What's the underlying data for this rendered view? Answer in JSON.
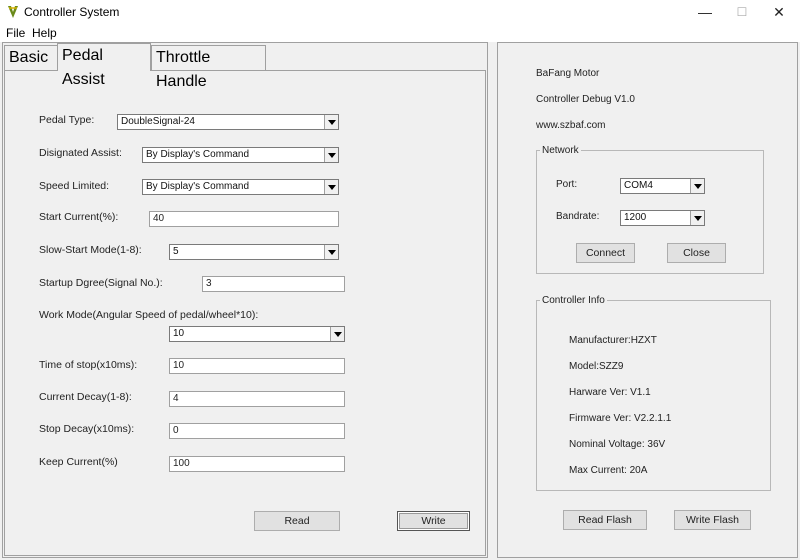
{
  "window": {
    "title": "Controller System",
    "minimize": "—",
    "maximize": "☐",
    "close": "✕"
  },
  "menu": {
    "file": "File",
    "help": "Help"
  },
  "tabs": {
    "basic": "Basic",
    "pedal_assist": "Pedal Assist",
    "throttle_handle": "Throttle Handle"
  },
  "form": {
    "pedal_type": {
      "label": "Pedal Type:",
      "value": "DoubleSignal-24"
    },
    "designated_assist": {
      "label": "Disignated Assist:",
      "value": "By Display's Command"
    },
    "speed_limited": {
      "label": "Speed Limited:",
      "value": "By Display's Command"
    },
    "start_current": {
      "label": "Start Current(%):",
      "value": "40"
    },
    "slow_start_mode": {
      "label": "Slow-Start Mode(1-8):",
      "value": "5"
    },
    "startup_degree": {
      "label": "Startup Dgree(Signal No.):",
      "value": "3"
    },
    "work_mode": {
      "label": "Work Mode(Angular Speed of pedal/wheel*10):",
      "value": "10"
    },
    "time_of_stop": {
      "label": "Time of stop(x10ms):",
      "value": "10"
    },
    "current_decay": {
      "label": "Current Decay(1-8):",
      "value": "4"
    },
    "stop_decay": {
      "label": "Stop Decay(x10ms):",
      "value": "0"
    },
    "keep_current": {
      "label": "Keep Current(%)",
      "value": "100"
    },
    "read_button": "Read",
    "write_button": "Write"
  },
  "about": {
    "brand": "BaFang Motor",
    "version": "Controller Debug V1.0",
    "website": "www.szbaf.com"
  },
  "network": {
    "title": "Network",
    "port_label": "Port:",
    "port_value": "COM4",
    "baudrate_label": "Bandrate:",
    "baudrate_value": "1200",
    "connect_button": "Connect",
    "close_button": "Close"
  },
  "controller_info": {
    "title": "Controller Info",
    "manufacturer": "Manufacturer:HZXT",
    "model": "Model:SZZ9",
    "hardware": "Harware Ver: V1.1",
    "firmware": "Firmware Ver: V2.2.1.1",
    "voltage": "Nominal Voltage: 36V",
    "max_current": "Max Current: 20A"
  },
  "flash": {
    "read": "Read Flash",
    "write": "Write Flash"
  }
}
